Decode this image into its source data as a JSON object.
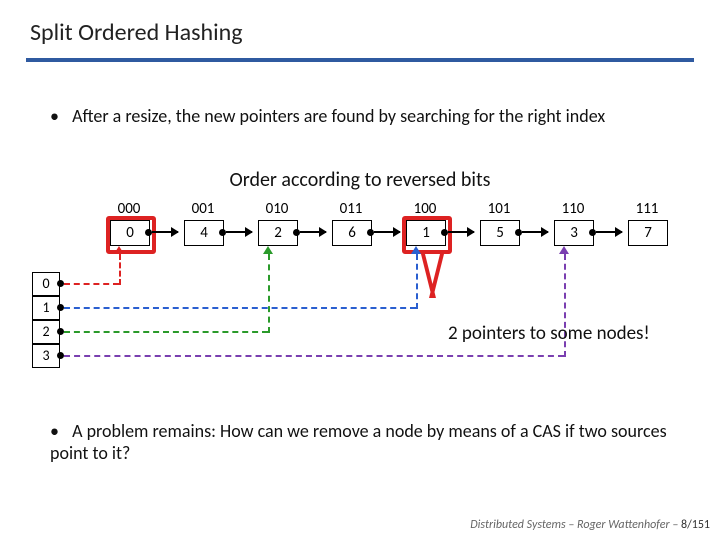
{
  "title": "Split Ordered Hashing",
  "bullets": {
    "b1_prefix": "•",
    "b1": "After a resize, the new pointers are found by searching for the right index",
    "b2_prefix": "•",
    "b2": "A problem remains: How can we remove a node by means of a CAS if two sources point to it?"
  },
  "caption": "Order according to reversed bits",
  "nodes": [
    {
      "bin": "000",
      "val": "0"
    },
    {
      "bin": "001",
      "val": "4"
    },
    {
      "bin": "010",
      "val": "2"
    },
    {
      "bin": "011",
      "val": "6"
    },
    {
      "bin": "100",
      "val": "1"
    },
    {
      "bin": "101",
      "val": "5"
    },
    {
      "bin": "110",
      "val": "3"
    },
    {
      "bin": "111",
      "val": "7"
    }
  ],
  "buckets": [
    "0",
    "1",
    "2",
    "3"
  ],
  "bucket_colors": [
    "#d22",
    "#2a5fd0",
    "#2a9a2a",
    "#7a3fb0"
  ],
  "note": "2 pointers to some nodes!",
  "footer_course": "Distributed Systems   –   Roger Wattenhofer   –",
  "footer_page": "8/151"
}
